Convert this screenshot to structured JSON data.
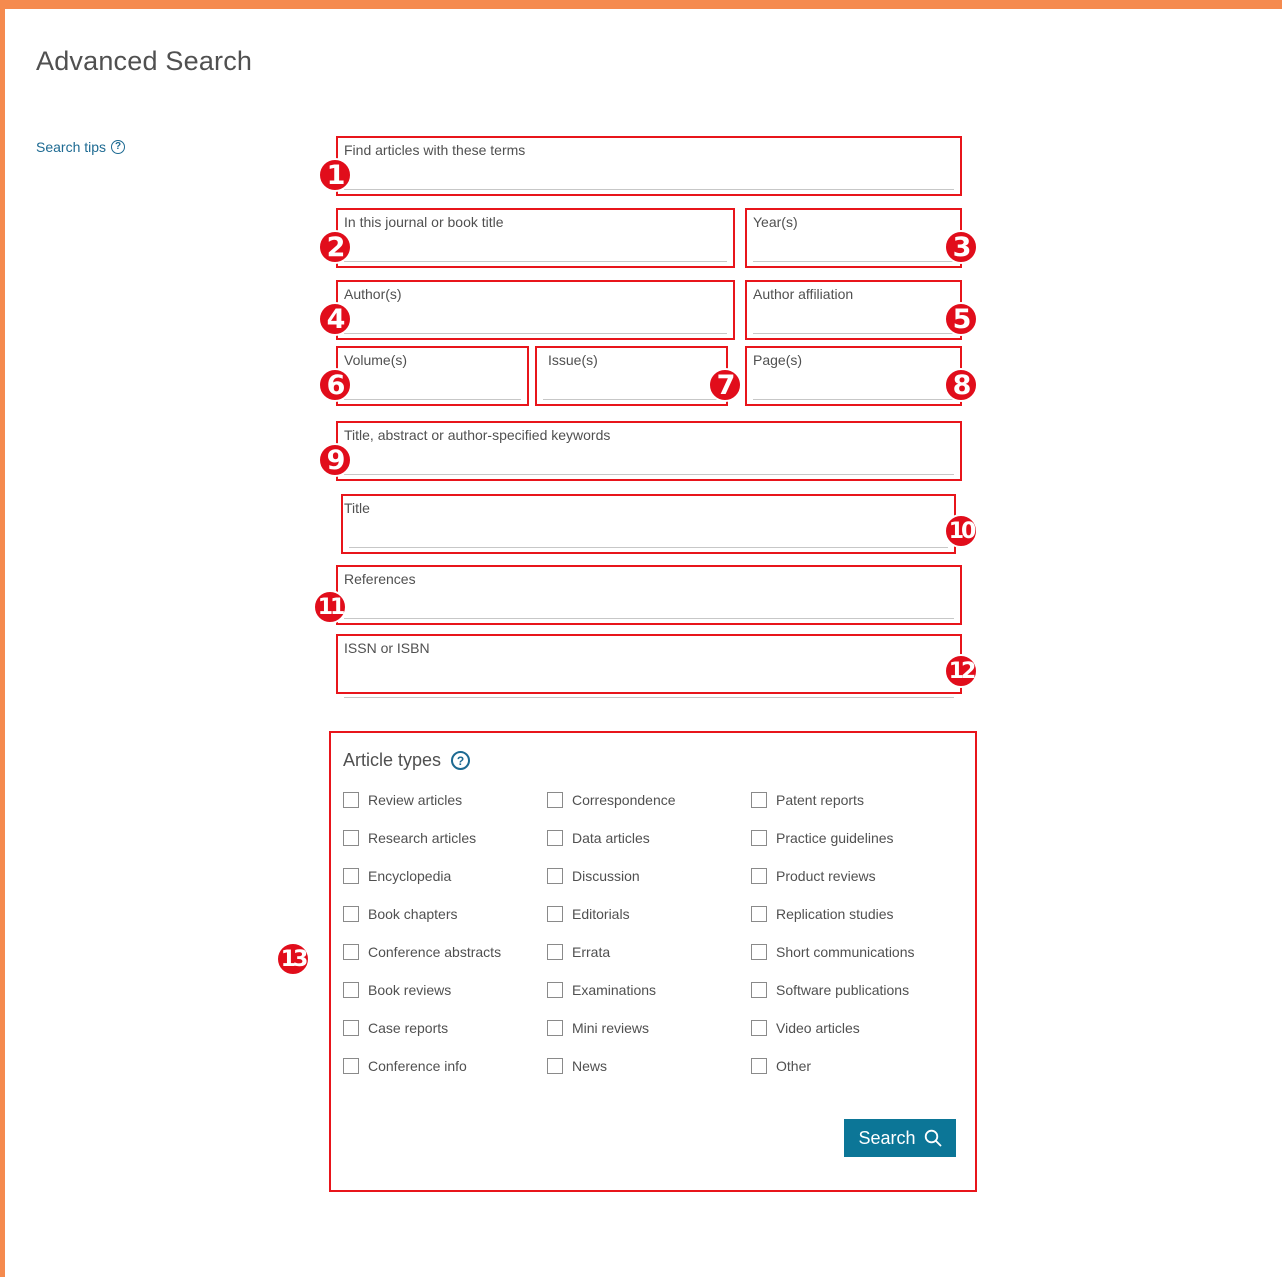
{
  "page_title": "Advanced Search",
  "search_tips": {
    "label": "Search tips",
    "icon": "help-circle-icon"
  },
  "fields": [
    {
      "label": "Find articles with these terms",
      "value": "",
      "marker": "1"
    },
    {
      "label": "In this journal or book title",
      "value": "",
      "marker": "2"
    },
    {
      "label": "Year(s)",
      "value": "",
      "marker": "3"
    },
    {
      "label": "Author(s)",
      "value": "",
      "marker": "4"
    },
    {
      "label": "Author affiliation",
      "value": "",
      "marker": "5"
    },
    {
      "label": "Volume(s)",
      "value": "",
      "marker": "6"
    },
    {
      "label": "Issue(s)",
      "value": "",
      "marker": "7"
    },
    {
      "label": "Page(s)",
      "value": "",
      "marker": "8"
    },
    {
      "label": "Title, abstract or author-specified keywords",
      "value": "",
      "marker": "9"
    },
    {
      "label": "Title",
      "value": "",
      "marker": "10"
    },
    {
      "label": "References",
      "value": "",
      "marker": "11"
    },
    {
      "label": "ISSN or ISBN",
      "value": "",
      "marker": "12"
    }
  ],
  "article_types": {
    "heading": "Article types",
    "marker": "13",
    "columns": [
      [
        "Review articles",
        "Research articles",
        "Encyclopedia",
        "Book chapters",
        "Conference abstracts",
        "Book reviews",
        "Case reports",
        "Conference info"
      ],
      [
        "Correspondence",
        "Data articles",
        "Discussion",
        "Editorials",
        "Errata",
        "Examinations",
        "Mini reviews",
        "News"
      ],
      [
        "Patent reports",
        "Practice guidelines",
        "Product reviews",
        "Replication studies",
        "Short communications",
        "Software publications",
        "Video articles",
        "Other"
      ]
    ]
  },
  "search_button": {
    "label": "Search",
    "icon": "search-icon"
  },
  "colors": {
    "frame": "#f58a4e",
    "highlight": "#e8151b",
    "marker": "#e10d1b",
    "link": "#1d6a92",
    "button": "#0c7697"
  }
}
